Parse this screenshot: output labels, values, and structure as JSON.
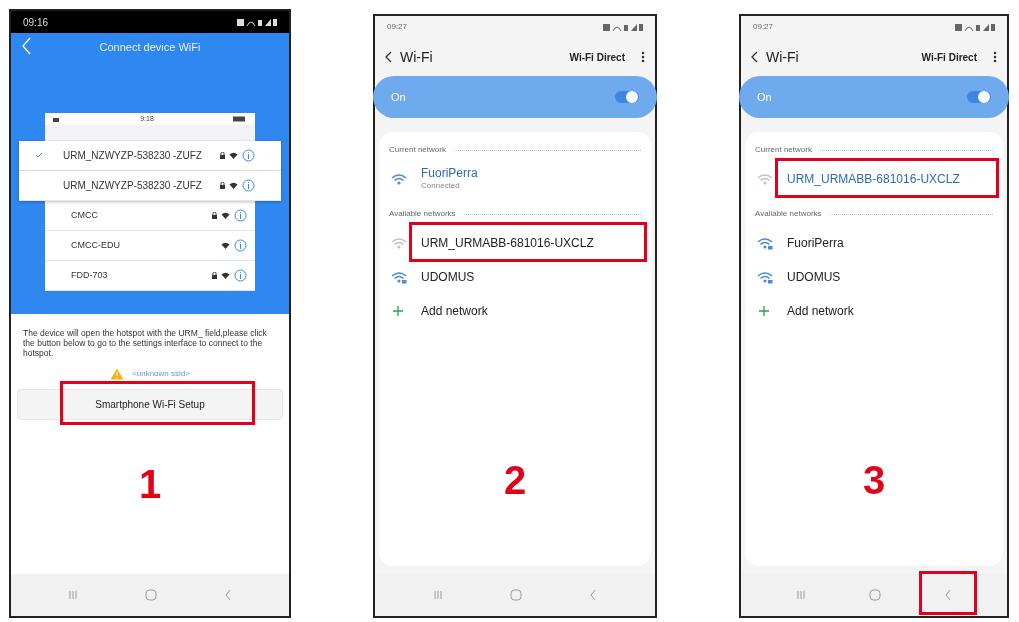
{
  "panels": [
    {
      "kind": "app",
      "status_time": "09:16",
      "title": "Connect device WiFi",
      "inner_time": "9:18",
      "networks": [
        {
          "name": "URM_NZWYZP-538230 -ZUFZ",
          "checked": true,
          "locked": true,
          "raised": true
        },
        {
          "name": "URM_NZWYZP-538230 -ZUFZ",
          "checked": false,
          "locked": true,
          "raised": true
        },
        {
          "name": "CMCC",
          "checked": false,
          "locked": true,
          "raised": false
        },
        {
          "name": "CMCC-EDU",
          "checked": false,
          "locked": false,
          "raised": false
        },
        {
          "name": "FDD-703",
          "checked": false,
          "locked": true,
          "raised": false
        }
      ],
      "instruction": "The device will open the hotspot with the URM_ field,please click the button below to go to the settings interface to connect to the hotspot.",
      "warning": "<unknown ssid>",
      "button": {
        "label": "Smartphone Wi-Fi Setup",
        "highlighted": true
      },
      "step": "1",
      "back_highlighted": false
    },
    {
      "kind": "settings",
      "status_time": "09:27",
      "title": "Wi-Fi",
      "action": "Wi-Fi Direct",
      "toggle": {
        "label": "On",
        "on": true
      },
      "current": {
        "heading": "Current network",
        "network": {
          "name": "FuoriPerra",
          "subtitle": "Connected",
          "highlighted": false
        }
      },
      "available": {
        "heading": "Available networks",
        "networks": [
          {
            "name": "URM_URMABB-681016-UXCLZ",
            "highlighted": true,
            "locked": false
          },
          {
            "name": "UDOMUS",
            "highlighted": false,
            "locked": true
          }
        ]
      },
      "add": "Add network",
      "step": "2",
      "back_highlighted": false
    },
    {
      "kind": "settings",
      "status_time": "09:27",
      "title": "Wi-Fi",
      "action": "Wi-Fi Direct",
      "toggle": {
        "label": "On",
        "on": true
      },
      "current": {
        "heading": "Current network",
        "network": {
          "name": "URM_URMABB-681016-UXCLZ",
          "highlighted": true
        }
      },
      "available": {
        "heading": "Available networks",
        "networks": [
          {
            "name": "FuoriPerra",
            "highlighted": false,
            "locked": true
          },
          {
            "name": "UDOMUS",
            "highlighted": false,
            "locked": true
          }
        ]
      },
      "add": "Add network",
      "step": "3",
      "back_highlighted": true
    }
  ]
}
